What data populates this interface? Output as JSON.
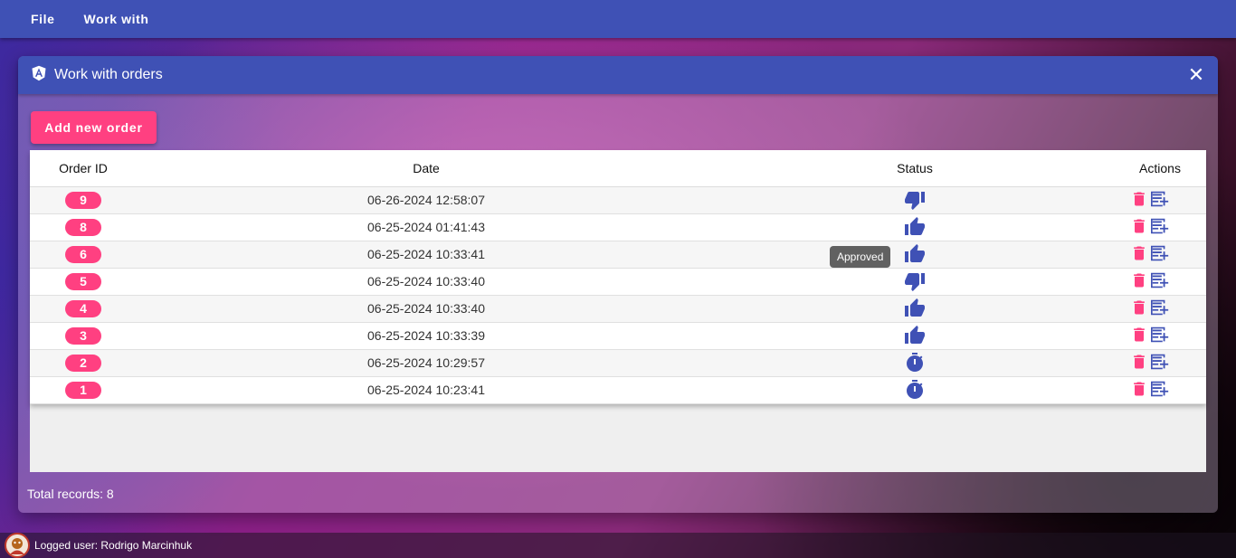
{
  "menu": {
    "file": "File",
    "work_with": "Work with"
  },
  "window": {
    "title": "Work with orders",
    "close_glyph": "✕"
  },
  "toolbar": {
    "add_label": "Add new order"
  },
  "table": {
    "headers": {
      "id": "Order ID",
      "date": "Date",
      "status": "Status",
      "actions": "Actions"
    },
    "rows": [
      {
        "id": "9",
        "date": "06-26-2024 12:58:07",
        "status": "rejected"
      },
      {
        "id": "8",
        "date": "06-25-2024 01:41:43",
        "status": "approved"
      },
      {
        "id": "6",
        "date": "06-25-2024 10:33:41",
        "status": "approved"
      },
      {
        "id": "5",
        "date": "06-25-2024 10:33:40",
        "status": "rejected"
      },
      {
        "id": "4",
        "date": "06-25-2024 10:33:40",
        "status": "approved"
      },
      {
        "id": "3",
        "date": "06-25-2024 10:33:39",
        "status": "approved"
      },
      {
        "id": "2",
        "date": "06-25-2024 10:29:57",
        "status": "pending"
      },
      {
        "id": "1",
        "date": "06-25-2024 10:23:41",
        "status": "pending"
      }
    ]
  },
  "tooltip": {
    "text": "Approved"
  },
  "footer": {
    "total": "Total records: 8"
  },
  "statusbar": {
    "user": "Logged user: Rodrigo Marcinhuk"
  },
  "icons": {
    "app": "angular-icon",
    "rejected": "thumb-down-icon",
    "approved": "thumb-up-icon",
    "pending": "timer-icon",
    "delete": "trash-icon",
    "edit": "edit-note-icon"
  },
  "colors": {
    "primary": "#3f51b5",
    "accent": "#ff4081"
  }
}
